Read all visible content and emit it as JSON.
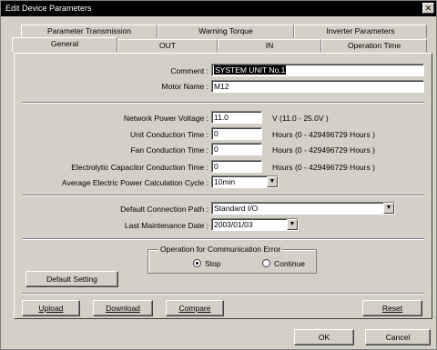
{
  "window": {
    "title": "Edit Device Parameters",
    "close_glyph": "✕"
  },
  "tabs": {
    "row1": [
      "Parameter Transmission",
      "Warning Torque",
      "Inverter Parameters"
    ],
    "row2": [
      "General",
      "OUT",
      "IN",
      "Operation Time"
    ],
    "active": "General"
  },
  "form": {
    "comment_label": "Comment :",
    "comment_value": "SYSTEM UNIT No.1",
    "motor_name_label": "Motor Name :",
    "motor_name_value": "M12",
    "network_voltage_label": "Network Power Voltage :",
    "network_voltage_value": "11.0",
    "network_voltage_hint": "V (11.0 - 25.0V )",
    "unit_conduction_label": "Unit Conduction Time :",
    "unit_conduction_value": "0",
    "unit_conduction_hint": "Hours (0 - 429496729 Hours )",
    "fan_conduction_label": "Fan Conduction Time :",
    "fan_conduction_value": "0",
    "fan_conduction_hint": "Hours (0 - 429496729 Hours )",
    "capacitor_label": "Electrolytic Capacitor Conduction Time :",
    "capacitor_value": "0",
    "capacitor_hint": "Hours (0 - 429496729 Hours )",
    "avg_power_label": "Average Electric Power Calculation Cycle :",
    "avg_power_value": "10min",
    "connection_path_label": "Default Connection Path :",
    "connection_path_value": "Standard I/O",
    "maintenance_label": "Last Maintenance Date :",
    "maintenance_value": "2003/01/03"
  },
  "comm_error": {
    "legend": "Operation for Communication Error",
    "options": [
      "Stop",
      "Continue"
    ],
    "selected": "Stop"
  },
  "buttons": {
    "default_setting": "Default Setting",
    "upload": "Upload",
    "download": "Download",
    "compare": "Compare",
    "reset": "Reset",
    "ok": "OK",
    "cancel": "Cancel"
  }
}
